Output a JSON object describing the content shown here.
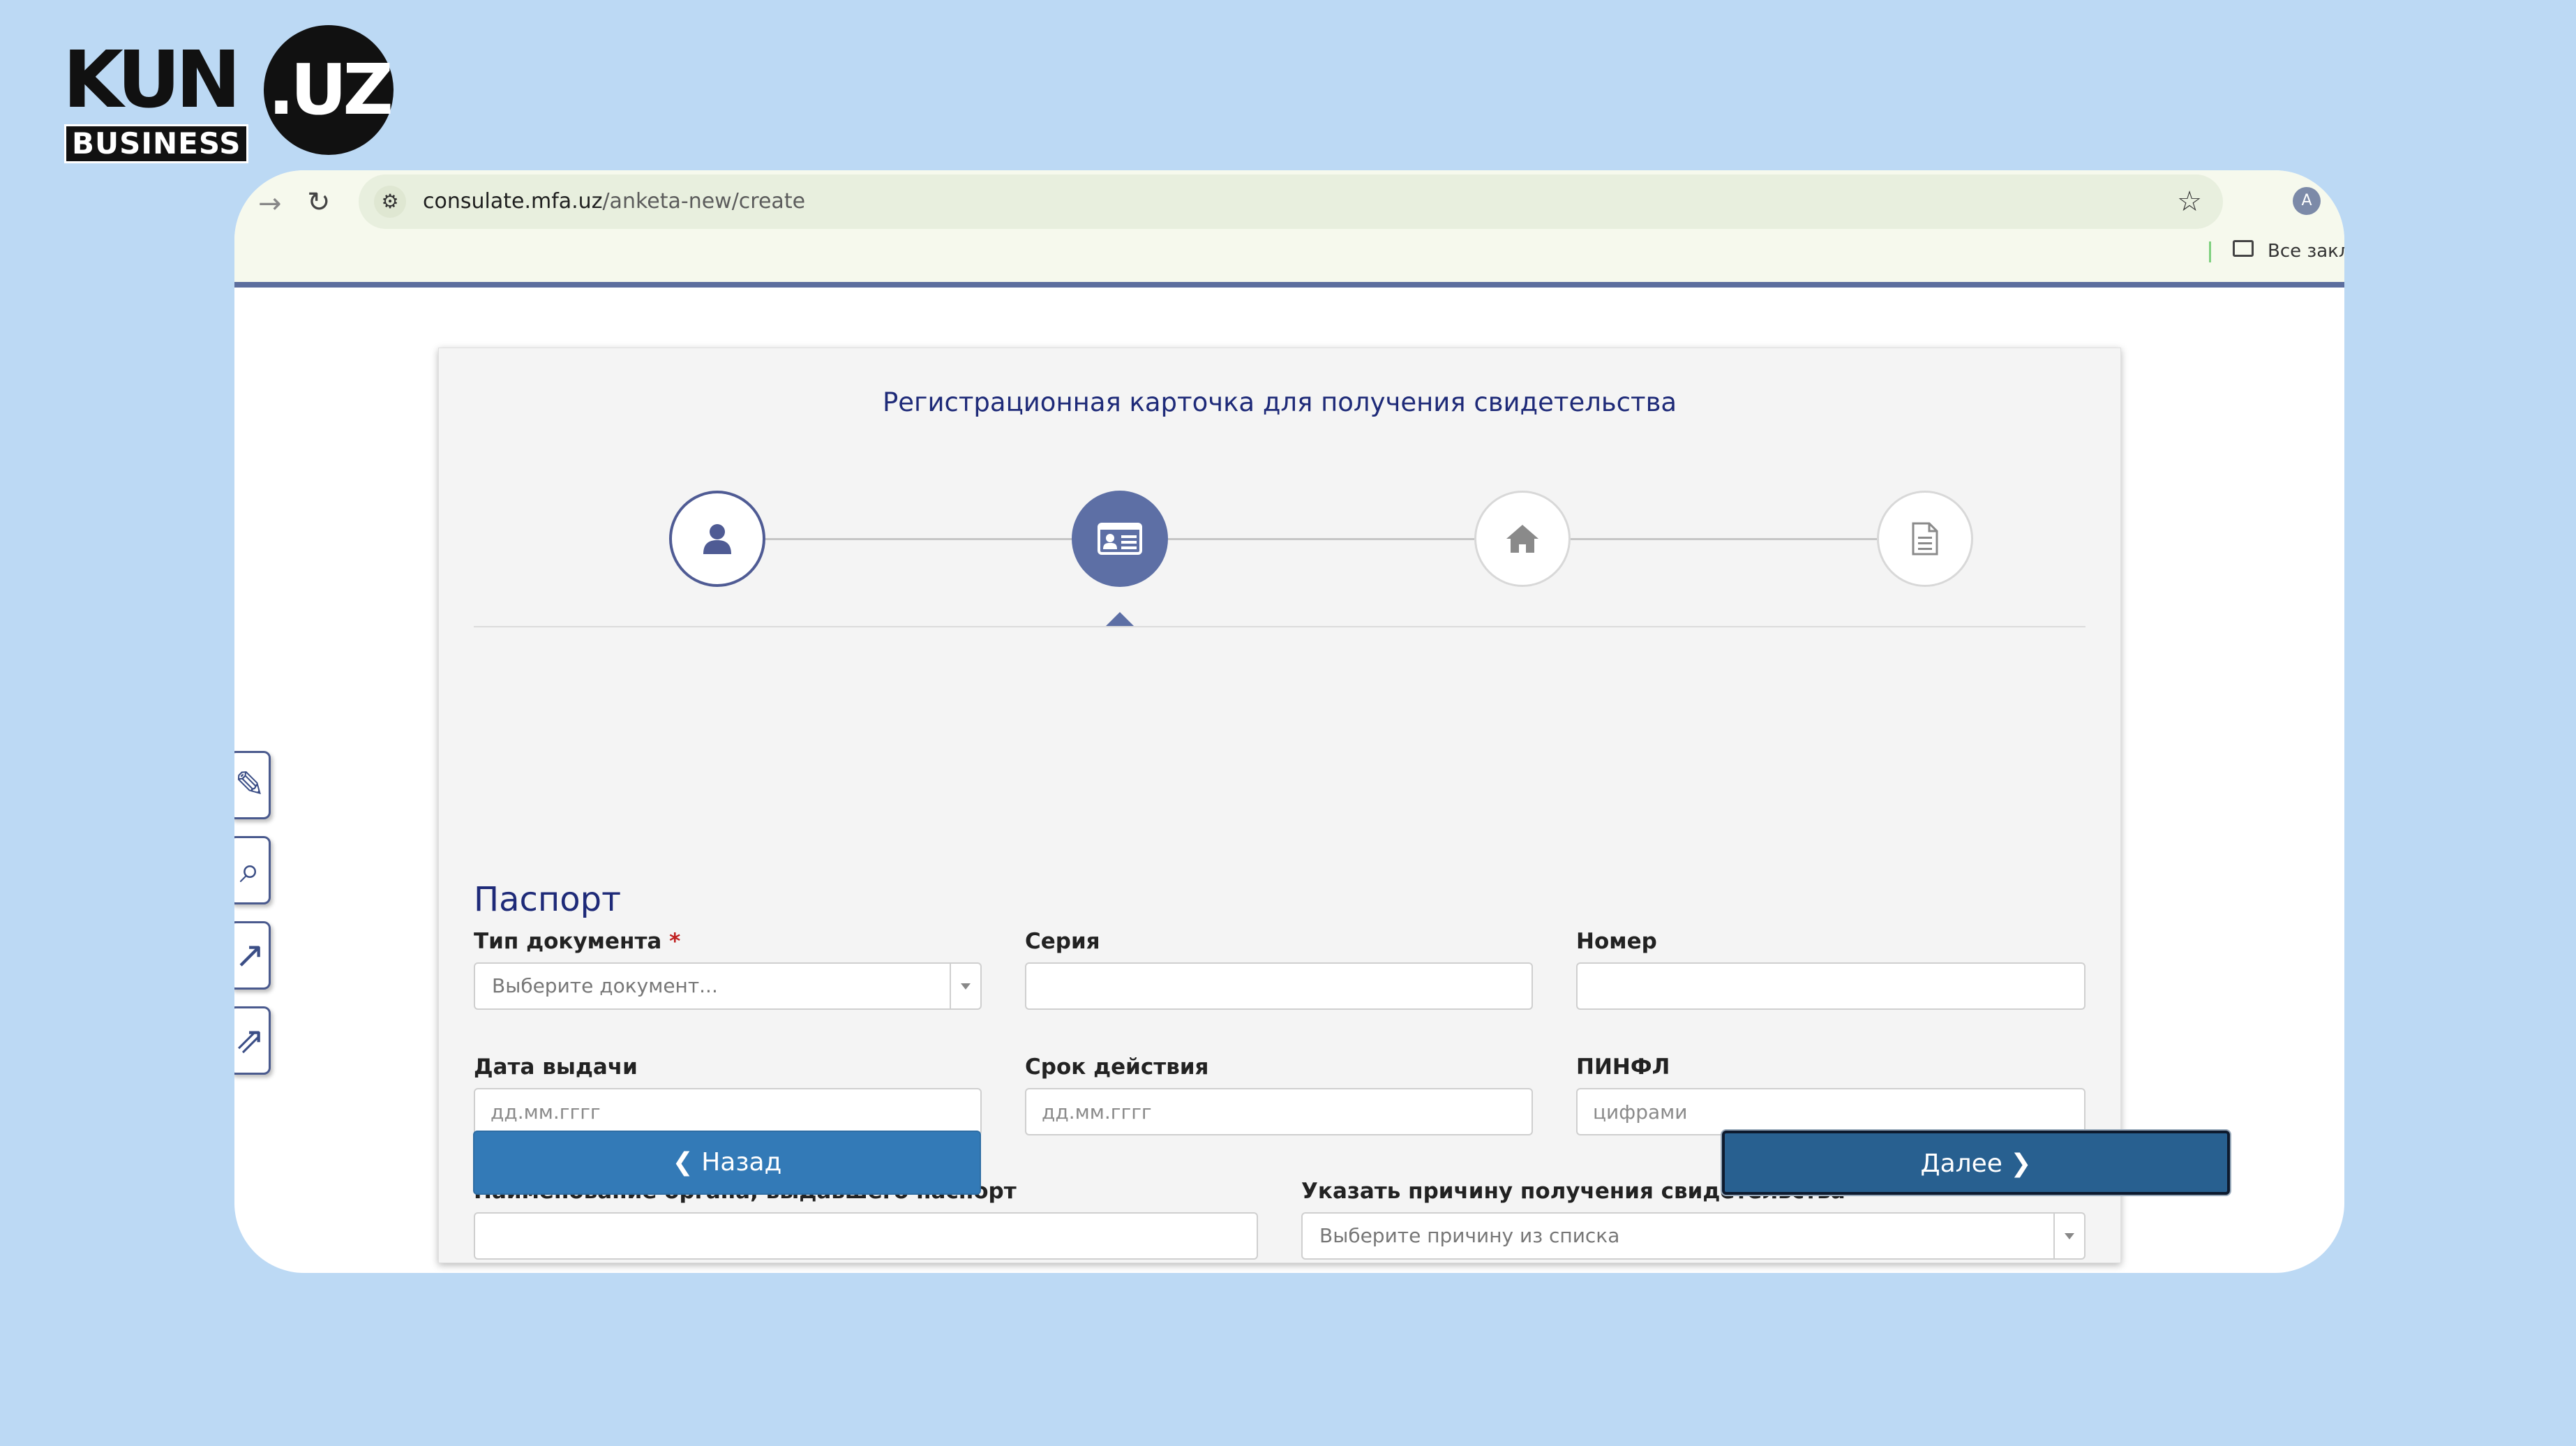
{
  "logo": {
    "main": "KUN",
    "circle": ".UZ",
    "sub": "BUSINESS"
  },
  "browser": {
    "url_host": "consulate.mfa.uz",
    "url_path": "/anketa-new/create",
    "profile_initial": "A",
    "bookmarks_label": "Все закла"
  },
  "form": {
    "title": "Регистрационная карточка для получения свидетельства",
    "steps": [
      {
        "icon": "user-icon",
        "state": "done"
      },
      {
        "icon": "id-card-icon",
        "state": "active"
      },
      {
        "icon": "home-icon",
        "state": "pending"
      },
      {
        "icon": "document-icon",
        "state": "pending"
      }
    ],
    "section_title": "Паспорт",
    "required_mark": "*",
    "fields": {
      "doc_type": {
        "label": "Тип документа",
        "placeholder": "Выберите документ..."
      },
      "series": {
        "label": "Серия",
        "placeholder": ""
      },
      "number": {
        "label": "Номер",
        "placeholder": ""
      },
      "issue_date": {
        "label": "Дата выдачи",
        "placeholder": "дд.мм.гггг"
      },
      "expiry_date": {
        "label": "Срок действия",
        "placeholder": "дд.мм.гггг"
      },
      "pinfl": {
        "label": "ПИНФЛ",
        "placeholder": "цифрами"
      },
      "issuer": {
        "label": "Наименование органа, выдавшего паспорт",
        "placeholder": ""
      },
      "reason": {
        "label": "Указать причину получения свидетельства",
        "placeholder": "Выберите причину из списка"
      }
    },
    "buttons": {
      "back": "Назад",
      "next": "Далее"
    }
  },
  "colors": {
    "page_bg": "#bcd9f4",
    "accent": "#5d6fa5",
    "title": "#1e2a78",
    "btn_back": "#337ab7",
    "btn_next": "#286090"
  }
}
